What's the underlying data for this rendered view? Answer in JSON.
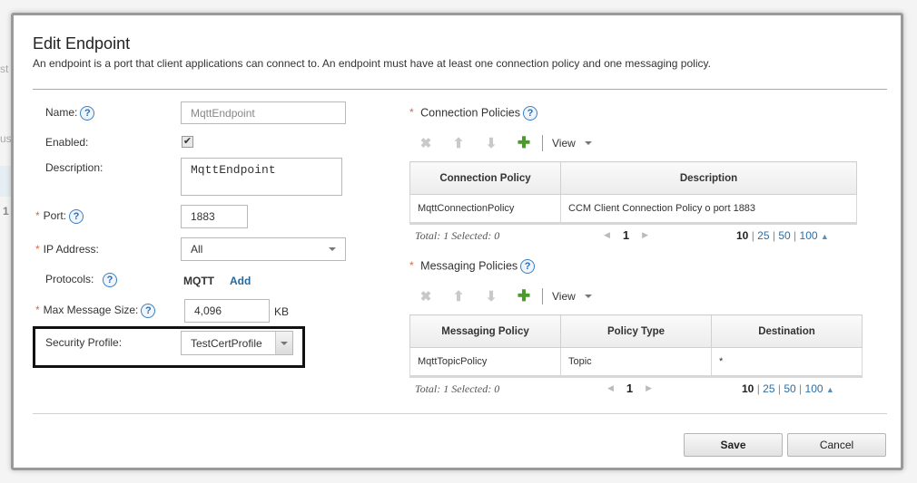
{
  "background": {
    "fragments": [
      "st N",
      "us",
      "1"
    ]
  },
  "dialog": {
    "title": "Edit Endpoint",
    "subtitle": "An endpoint is a port that client applications can connect to. An endpoint must have at least one connection policy and one messaging policy.",
    "required_marker": "*",
    "help_glyph": "?",
    "form": {
      "name": {
        "label": "Name:",
        "value": "MqttEndpoint"
      },
      "enabled": {
        "label": "Enabled:",
        "checked": true,
        "check_glyph": "✔"
      },
      "description": {
        "label": "Description:",
        "value": "MqttEndpoint"
      },
      "port": {
        "label": "Port:",
        "value": "1883"
      },
      "ip_address": {
        "label": "IP Address:",
        "value": "All"
      },
      "protocols": {
        "label": "Protocols:",
        "value": "MQTT",
        "add_label": "Add"
      },
      "max_message_size": {
        "label": "Max Message Size:",
        "value": "4,096",
        "unit": "KB"
      },
      "security_profile": {
        "label": "Security Profile:",
        "value": "TestCertProfile"
      }
    },
    "connection_policies": {
      "title": "Connection Policies",
      "toolbar": {
        "view_label": "View"
      },
      "columns": [
        "Connection Policy",
        "Description"
      ],
      "rows": [
        [
          "MqttConnectionPolicy",
          "CCM Client Connection Policy o port 1883"
        ]
      ],
      "pager": {
        "total_text": "Total: 1 Selected: 0",
        "page": "1",
        "sizes": [
          "10",
          "25",
          "50",
          "100"
        ],
        "current_size": "10",
        "sep": "|"
      }
    },
    "messaging_policies": {
      "title": "Messaging Policies",
      "toolbar": {
        "view_label": "View"
      },
      "columns": [
        "Messaging Policy",
        "Policy Type",
        "Destination"
      ],
      "rows": [
        [
          "MqttTopicPolicy",
          "Topic",
          "*"
        ]
      ],
      "pager": {
        "total_text": "Total: 1 Selected: 0",
        "page": "1",
        "sizes": [
          "10",
          "25",
          "50",
          "100"
        ],
        "current_size": "10",
        "sep": "|"
      }
    },
    "buttons": {
      "save": "Save",
      "cancel": "Cancel"
    }
  },
  "icons": {
    "delete": "✖",
    "move_up": "⬆",
    "move_down": "⬇",
    "add": "✚",
    "page_prev": "◀",
    "page_next": "▶",
    "sort_up": "▲"
  }
}
